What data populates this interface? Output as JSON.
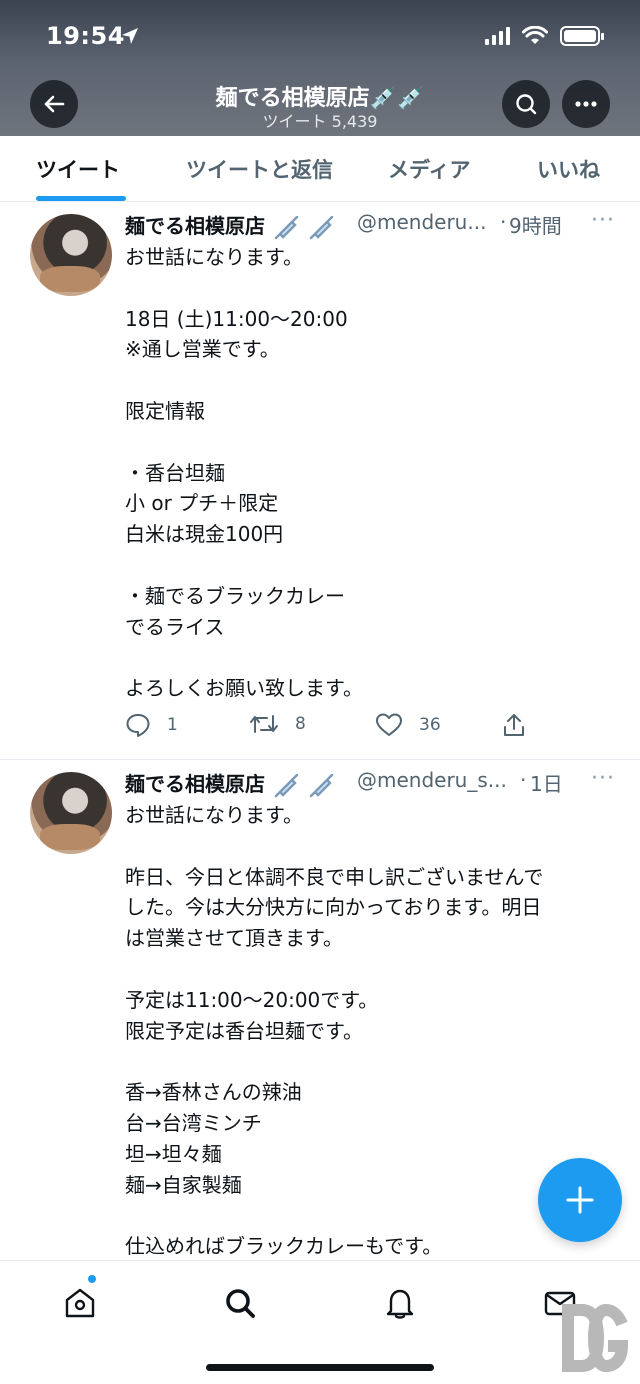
{
  "status_bar": {
    "time": "19:54"
  },
  "header": {
    "title": "麺でる相模原店💉💉",
    "subtitle": "ツイート 5,439"
  },
  "tabs": [
    {
      "label": "ツイート",
      "active": true
    },
    {
      "label": "ツイートと返信",
      "active": false
    },
    {
      "label": "メディア",
      "active": false
    },
    {
      "label": "いいね",
      "active": false
    }
  ],
  "tweets": [
    {
      "name": "麺でる相模原店",
      "handle": "@menderu...",
      "dot": "·",
      "time": "9時間",
      "more": "···",
      "body": "お世話になります。\n\n18日 (土)11:00～20:00\n※通し営業です。\n\n限定情報\n\n・香台坦麺\n小 or プチ＋限定\n白米は現金100円\n\n・麺でるブラックカレー\nでるライス\n\nよろしくお願い致します。",
      "replies": "1",
      "retweets": "8",
      "likes": "36"
    },
    {
      "name": "麺でる相模原店",
      "handle": "@menderu_s...",
      "dot": "·",
      "time": "1日",
      "more": "···",
      "body": "お世話になります。\n\n昨日、今日と体調不良で申し訳ございませんで\nした。今は大分快方に向かっております。明日\nは営業させて頂きます。\n\n予定は11:00～20:00です。\n限定予定は香台坦麺です。\n\n香→香林さんの辣油\n台→台湾ミンチ\n坦→坦々麺\n麺→自家製麺\n\n仕込めればブラックカレーもです。"
    }
  ],
  "colors": {
    "accent": "#1d9bf0",
    "text": "#0f1419",
    "muted": "#536471"
  },
  "icons": [
    "back-arrow-icon",
    "search-icon",
    "more-icon",
    "reply-icon",
    "retweet-icon",
    "like-icon",
    "share-icon",
    "compose-plus-icon",
    "home-icon",
    "explore-icon",
    "notifications-icon",
    "messages-icon"
  ]
}
